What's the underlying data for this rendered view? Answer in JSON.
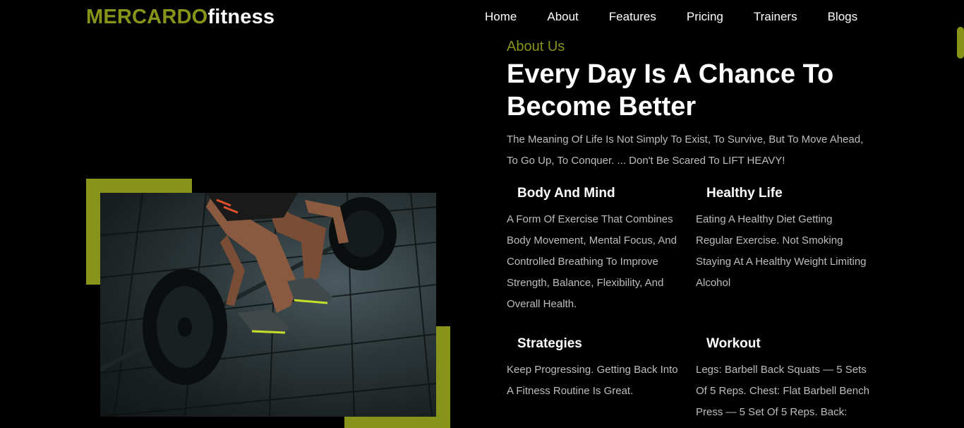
{
  "header": {
    "logo_brand": "MERCARDO",
    "logo_suffix": "fitness",
    "nav": [
      "Home",
      "About",
      "Features",
      "Pricing",
      "Trainers",
      "Blogs"
    ]
  },
  "about": {
    "eyebrow": "About Us",
    "headline_line1": "Every Day Is A Chance To",
    "headline_line2": "Become Better",
    "intro": "The Meaning Of Life Is Not Simply To Exist, To Survive, But To Move Ahead, To Go Up, To Conquer. ... Don't Be Scared To LIFT HEAVY!",
    "features": [
      {
        "title": "Body And Mind",
        "text": "A Form Of Exercise That Combines Body Movement, Mental Focus, And Controlled Breathing To Improve Strength, Balance, Flexibility, And Overall Health."
      },
      {
        "title": "Healthy Life",
        "text": "Eating A Healthy Diet Getting Regular Exercise. Not Smoking Staying At A Healthy Weight Limiting Alcohol"
      },
      {
        "title": "Strategies",
        "text": "Keep Progressing. Getting Back Into A Fitness Routine Is Great."
      },
      {
        "title": "Workout",
        "text": "Legs: Barbell Back Squats — 5 Sets Of 5 Reps. Chest: Flat Barbell Bench Press — 5 Set Of 5 Reps. Back:"
      }
    ]
  },
  "colors": {
    "accent": "#88931a",
    "background": "#000000",
    "body_text": "#bdbdbd"
  }
}
